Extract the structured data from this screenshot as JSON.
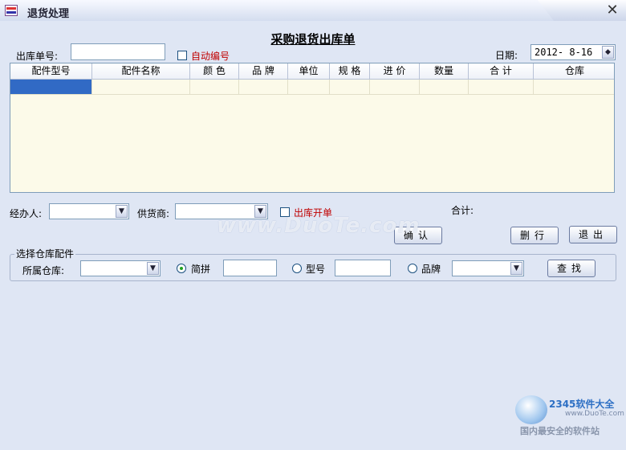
{
  "window": {
    "title": "退货处理",
    "close_glyph": "✕"
  },
  "form_title": "采购退货出库单",
  "header": {
    "order_no_label": "出库单号:",
    "order_no_value": "",
    "auto_number_label": "自动编号",
    "date_label": "日期:",
    "date_value": "2012- 8-16"
  },
  "grid": {
    "columns": [
      "配件型号",
      "配件名称",
      "颜 色",
      "品 牌",
      "单位",
      "规 格",
      "进 价",
      "数量",
      "合 计",
      "仓库"
    ],
    "rows": [
      [
        "",
        "",
        "",
        "",
        "",
        "",
        "",
        "",
        "",
        ""
      ]
    ]
  },
  "middle": {
    "handler_label": "经办人:",
    "handler_value": "",
    "supplier_label": "供货商:",
    "supplier_value": "",
    "issue_bill_label": "出库开单",
    "total_label": "合计:",
    "confirm_label": "确认",
    "delete_row_label": "删行",
    "exit_label": "退出"
  },
  "warehouse_group": {
    "title": "选择仓库配件",
    "warehouse_label": "所属仓库:",
    "warehouse_value": "",
    "pinyin_label": "简拼",
    "pinyin_value": "",
    "model_label": "型号",
    "model_value": "",
    "brand_label": "品牌",
    "brand_value": "",
    "search_label": "查找",
    "selected_option": "简拼"
  },
  "watermark": "www.DuoTe.com",
  "corner_logo": {
    "brand": "2345软件大全",
    "url": "www.DuoTe.com",
    "slogan": "国内最安全的软件站"
  },
  "icons": [
    "app-icon",
    "close-icon",
    "dropdown-arrow-icon",
    "checkbox-icon",
    "radio-icon"
  ],
  "colors": {
    "grid_bg": "#fcfae9",
    "selection": "#316ac5",
    "window_bg": "#dfe6f4",
    "accent_red": "#c00000"
  }
}
